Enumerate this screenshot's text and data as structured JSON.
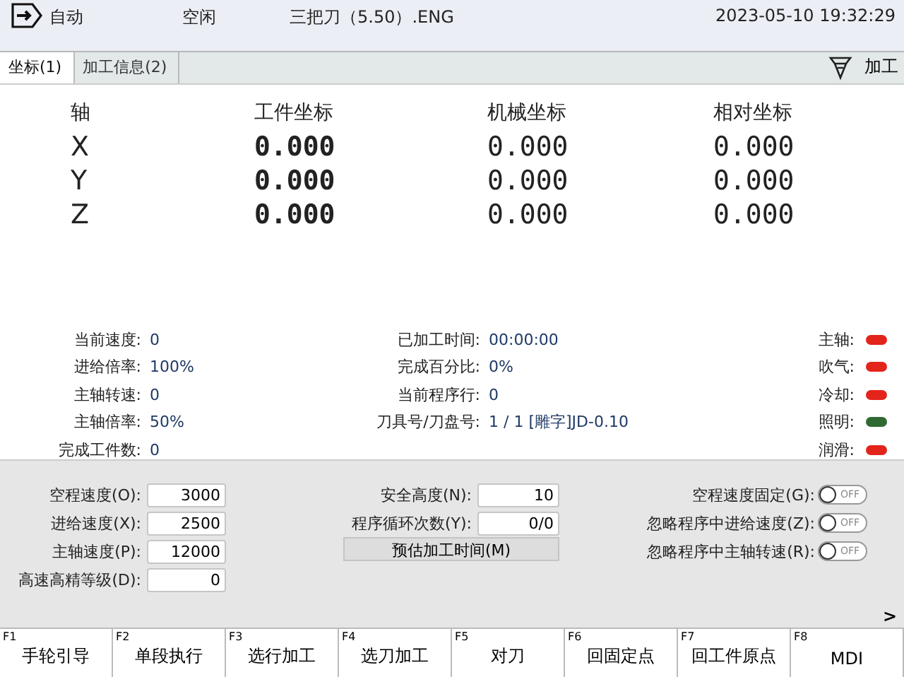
{
  "status_bar": {
    "mode": "自动",
    "state": "空闲",
    "program": "三把刀（5.50）.ENG",
    "datetime": "2023-05-10 19:32:29"
  },
  "tabs": [
    {
      "label": "坐标(1)",
      "selected": true
    },
    {
      "label": "加工信息(2)",
      "selected": false
    }
  ],
  "process_button": {
    "label": "加工"
  },
  "coordinates": {
    "columns": [
      "轴",
      "工件坐标",
      "机械坐标",
      "相对坐标"
    ],
    "rows": [
      [
        "X",
        "0.000",
        "0.000",
        "0.000"
      ],
      [
        "Y",
        "0.000",
        "0.000",
        "0.000"
      ],
      [
        "Z",
        "0.000",
        "0.000",
        "0.000"
      ]
    ]
  },
  "status_left": [
    {
      "label": "当前速度:",
      "value": "0"
    },
    {
      "label": "进给倍率:",
      "value": "100%"
    },
    {
      "label": "主轴转速:",
      "value": "0"
    },
    {
      "label": "主轴倍率:",
      "value": "50%"
    },
    {
      "label": "完成工件数:",
      "value": "0"
    }
  ],
  "status_middle": [
    {
      "label": "已加工时间:",
      "value": "00:00:00"
    },
    {
      "label": "完成百分比:",
      "value": "0%"
    },
    {
      "label": "当前程序行:",
      "value": "0"
    },
    {
      "label": "刀具号/刀盘号:",
      "value": "1 / 1 [雕字]JD-0.10"
    }
  ],
  "indicators": [
    {
      "label": "主轴:",
      "color": "#e3241b"
    },
    {
      "label": "吹气:",
      "color": "#e3241b"
    },
    {
      "label": "冷却:",
      "color": "#e3241b"
    },
    {
      "label": "照明:",
      "color": "#2f6a33"
    },
    {
      "label": "润滑:",
      "color": "#e3241b"
    }
  ],
  "settings_left": [
    {
      "label": "空程速度(O):",
      "value": "3000"
    },
    {
      "label": "进给速度(X):",
      "value": "2500"
    },
    {
      "label": "主轴速度(P):",
      "value": "12000"
    },
    {
      "label": "高速高精等级(D):",
      "value": "0"
    }
  ],
  "settings_middle": [
    {
      "label": "安全高度(N):",
      "value": "10"
    },
    {
      "label": "程序循环次数(Y):",
      "value": "0/0"
    }
  ],
  "estimate_button": {
    "label": "预估加工时间(M)"
  },
  "toggles": [
    {
      "label": "空程速度固定(G):",
      "on": false,
      "text": "OFF"
    },
    {
      "label": "忽略程序中进给速度(Z):",
      "on": false,
      "text": "OFF"
    },
    {
      "label": "忽略程序中主轴转速(R):",
      "on": false,
      "text": "OFF"
    }
  ],
  "more_button": {
    "label": ">"
  },
  "function_keys": [
    {
      "key": "F1",
      "label": "手轮引导"
    },
    {
      "key": "F2",
      "label": "单段执行"
    },
    {
      "key": "F3",
      "label": "选行加工"
    },
    {
      "key": "F4",
      "label": "选刀加工"
    },
    {
      "key": "F5",
      "label": "对刀"
    },
    {
      "key": "F6",
      "label": "回固定点"
    },
    {
      "key": "F7",
      "label": "回工件原点"
    },
    {
      "key": "F8",
      "label": "MDI"
    }
  ]
}
